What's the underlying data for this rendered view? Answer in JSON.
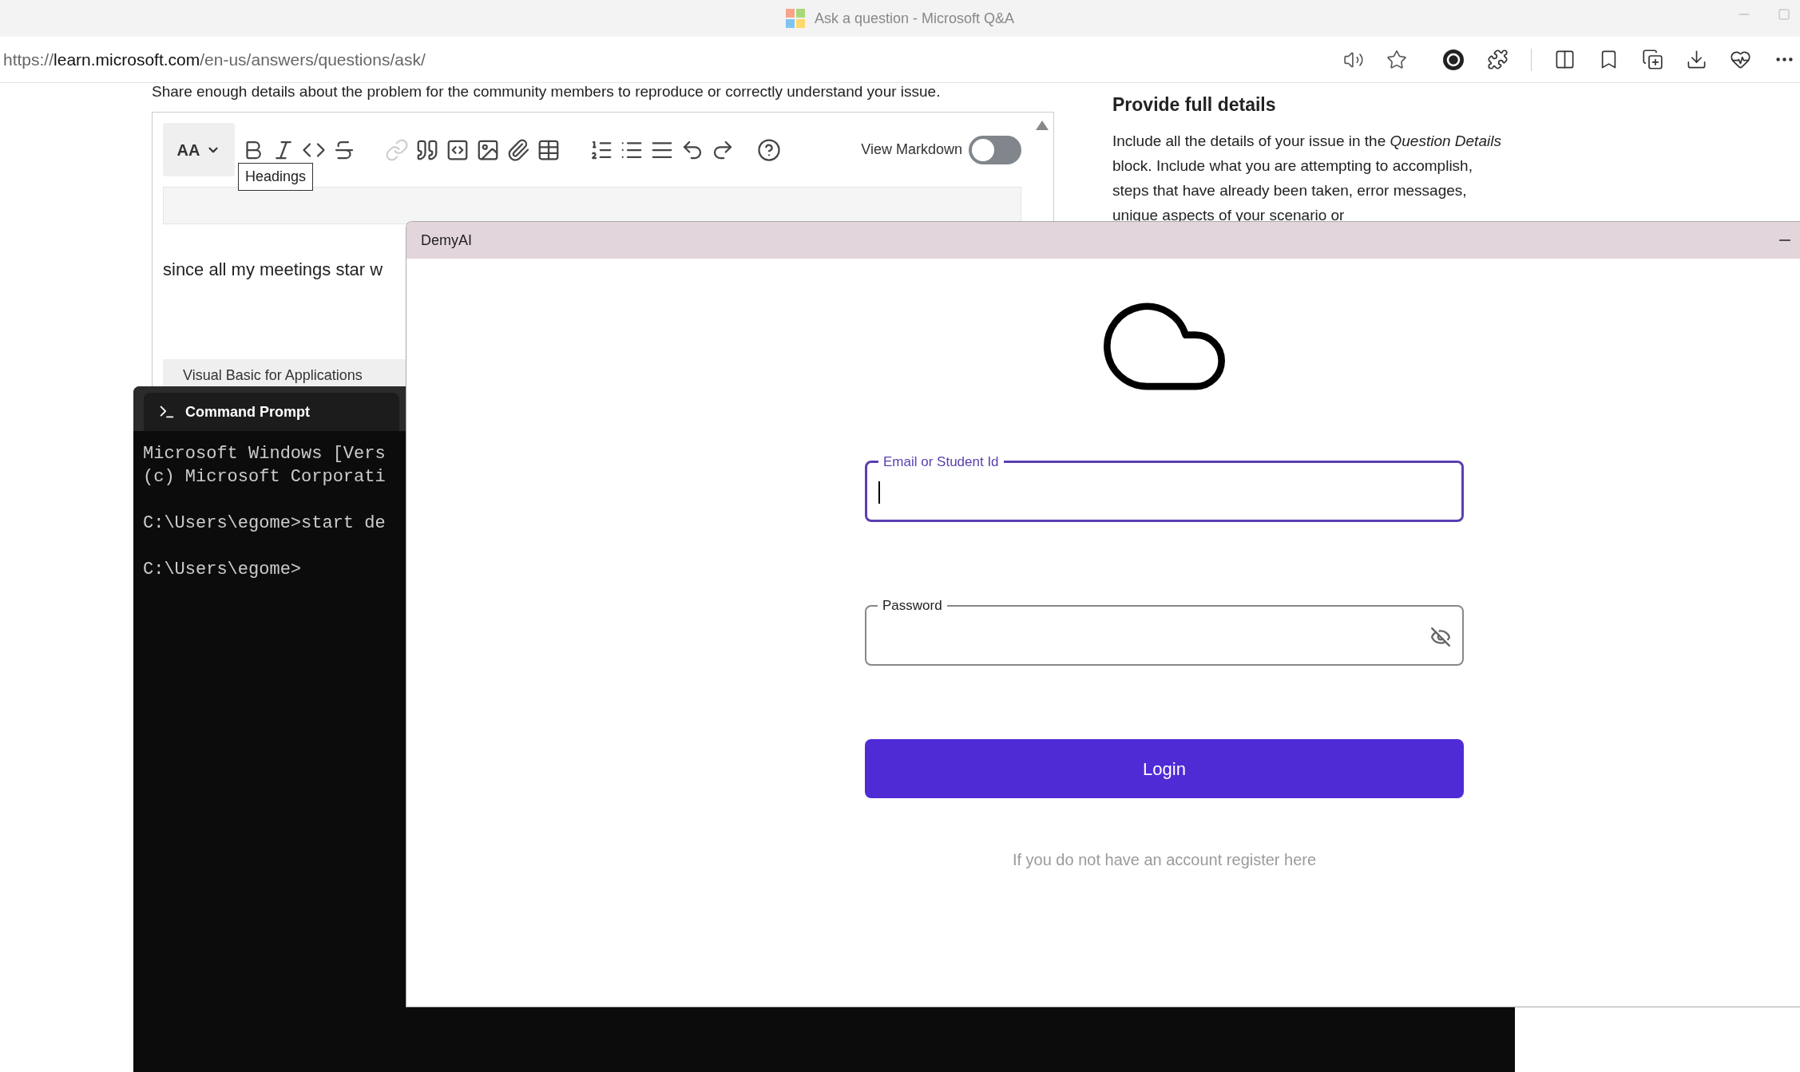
{
  "browser": {
    "title": "Ask a question - Microsoft Q&A",
    "url": {
      "scheme": "https://",
      "host": "learn.microsoft.com",
      "path": "/en-us/answers/questions/ask/"
    }
  },
  "page": {
    "instruction": "Share enough details about the problem for the community members to reproduce or correctly understand your issue.",
    "editor": {
      "headings_label": "AA",
      "tooltip": "Headings",
      "toolbar_groups": [
        [
          {
            "kind": "bold",
            "disabled": false
          },
          {
            "kind": "italic",
            "disabled": false
          },
          {
            "kind": "code",
            "disabled": false
          },
          {
            "kind": "strike",
            "disabled": false
          }
        ],
        [
          {
            "kind": "link",
            "disabled": true
          },
          {
            "kind": "quote",
            "disabled": false
          },
          {
            "kind": "codeblock",
            "disabled": false
          },
          {
            "kind": "image",
            "disabled": false
          },
          {
            "kind": "attach",
            "disabled": false
          },
          {
            "kind": "table",
            "disabled": false
          }
        ],
        [
          {
            "kind": "ordered",
            "disabled": false
          },
          {
            "kind": "bullets",
            "disabled": false
          },
          {
            "kind": "rule",
            "disabled": false
          },
          {
            "kind": "undo",
            "disabled": false
          },
          {
            "kind": "redo",
            "disabled": false
          }
        ],
        [
          {
            "kind": "help",
            "disabled": false
          }
        ]
      ],
      "view_markdown": {
        "label": "View Markdown",
        "on": false
      },
      "body_text": "since all my meetings star w",
      "tag": "Visual Basic for Applications"
    },
    "sidebar": {
      "heading": "Provide full details",
      "paragraph": "Include all the details of your issue in the *Question Details* block. Include what you are attempting to accomplish, steps that have already been taken, error messages, unique aspects of your scenario or"
    }
  },
  "cmd_window": {
    "title": "Command Prompt",
    "blocks": [
      [
        "Microsoft Windows [Vers",
        "(c) Microsoft Corporati"
      ],
      [
        "C:\\Users\\egome>start de"
      ],
      [
        "C:\\Users\\egome>"
      ]
    ]
  },
  "login_window": {
    "title": "DemyAI",
    "email": {
      "label": "Email or Student Id",
      "focused": true
    },
    "password": {
      "label": "Password"
    },
    "login_button": "Login",
    "register_text": "If you do not have an account register here"
  }
}
